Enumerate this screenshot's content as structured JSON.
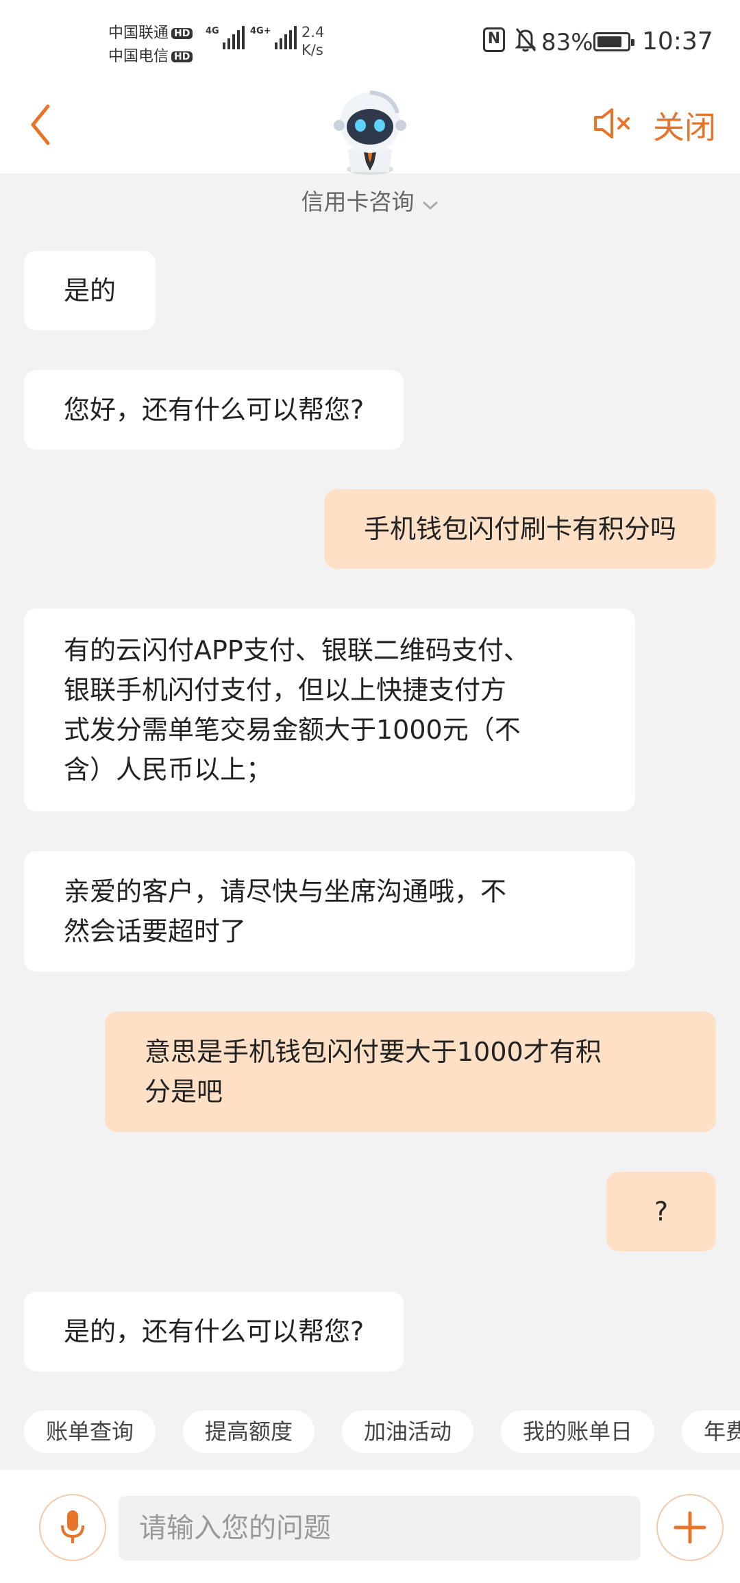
{
  "status_bar": {
    "carrier1": "中国联通",
    "carrier2": "中国电信",
    "hd_label": "HD",
    "net1": "4G",
    "net2": "4G+",
    "speed_value": "2.4",
    "speed_unit": "K/s",
    "battery_percent": "83%",
    "battery_level": 0.83,
    "time": "10:37"
  },
  "header": {
    "close_label": "关闭",
    "topic": "信用卡咨询"
  },
  "messages": [
    {
      "from": "bot",
      "text": "是的"
    },
    {
      "from": "bot",
      "text": "您好，还有什么可以帮您?"
    },
    {
      "from": "user",
      "text": "手机钱包闪付刷卡有积分吗"
    },
    {
      "from": "bot",
      "text": "有的云闪付APP支付、银联二维码支付、\n银联手机闪付支付，但以上快捷支付方\n式发分需单笔交易金额大于1000元（不\n含）人民币以上；"
    },
    {
      "from": "bot",
      "text": "亲爱的客户，请尽快与坐席沟通哦，不\n然会话要超时了"
    },
    {
      "from": "user",
      "text": "意思是手机钱包闪付要大于1000才有积\n分是吧"
    },
    {
      "from": "user",
      "text": "?"
    },
    {
      "from": "bot",
      "text": "是的，还有什么可以帮您?"
    }
  ],
  "quick_replies": [
    "账单查询",
    "提高额度",
    "加油活动",
    "我的账单日",
    "年费"
  ],
  "input": {
    "placeholder": "请输入您的问题",
    "value": ""
  },
  "icons": {
    "back": "chevron-left-icon",
    "mute": "speaker-mute-icon",
    "mic": "microphone-icon",
    "plus": "plus-icon",
    "avatar": "robot-avatar-icon"
  },
  "colors": {
    "accent": "#e8742a",
    "user_bubble": "#fde0c6",
    "bot_bubble": "#ffffff",
    "background": "#f2f2f2"
  }
}
